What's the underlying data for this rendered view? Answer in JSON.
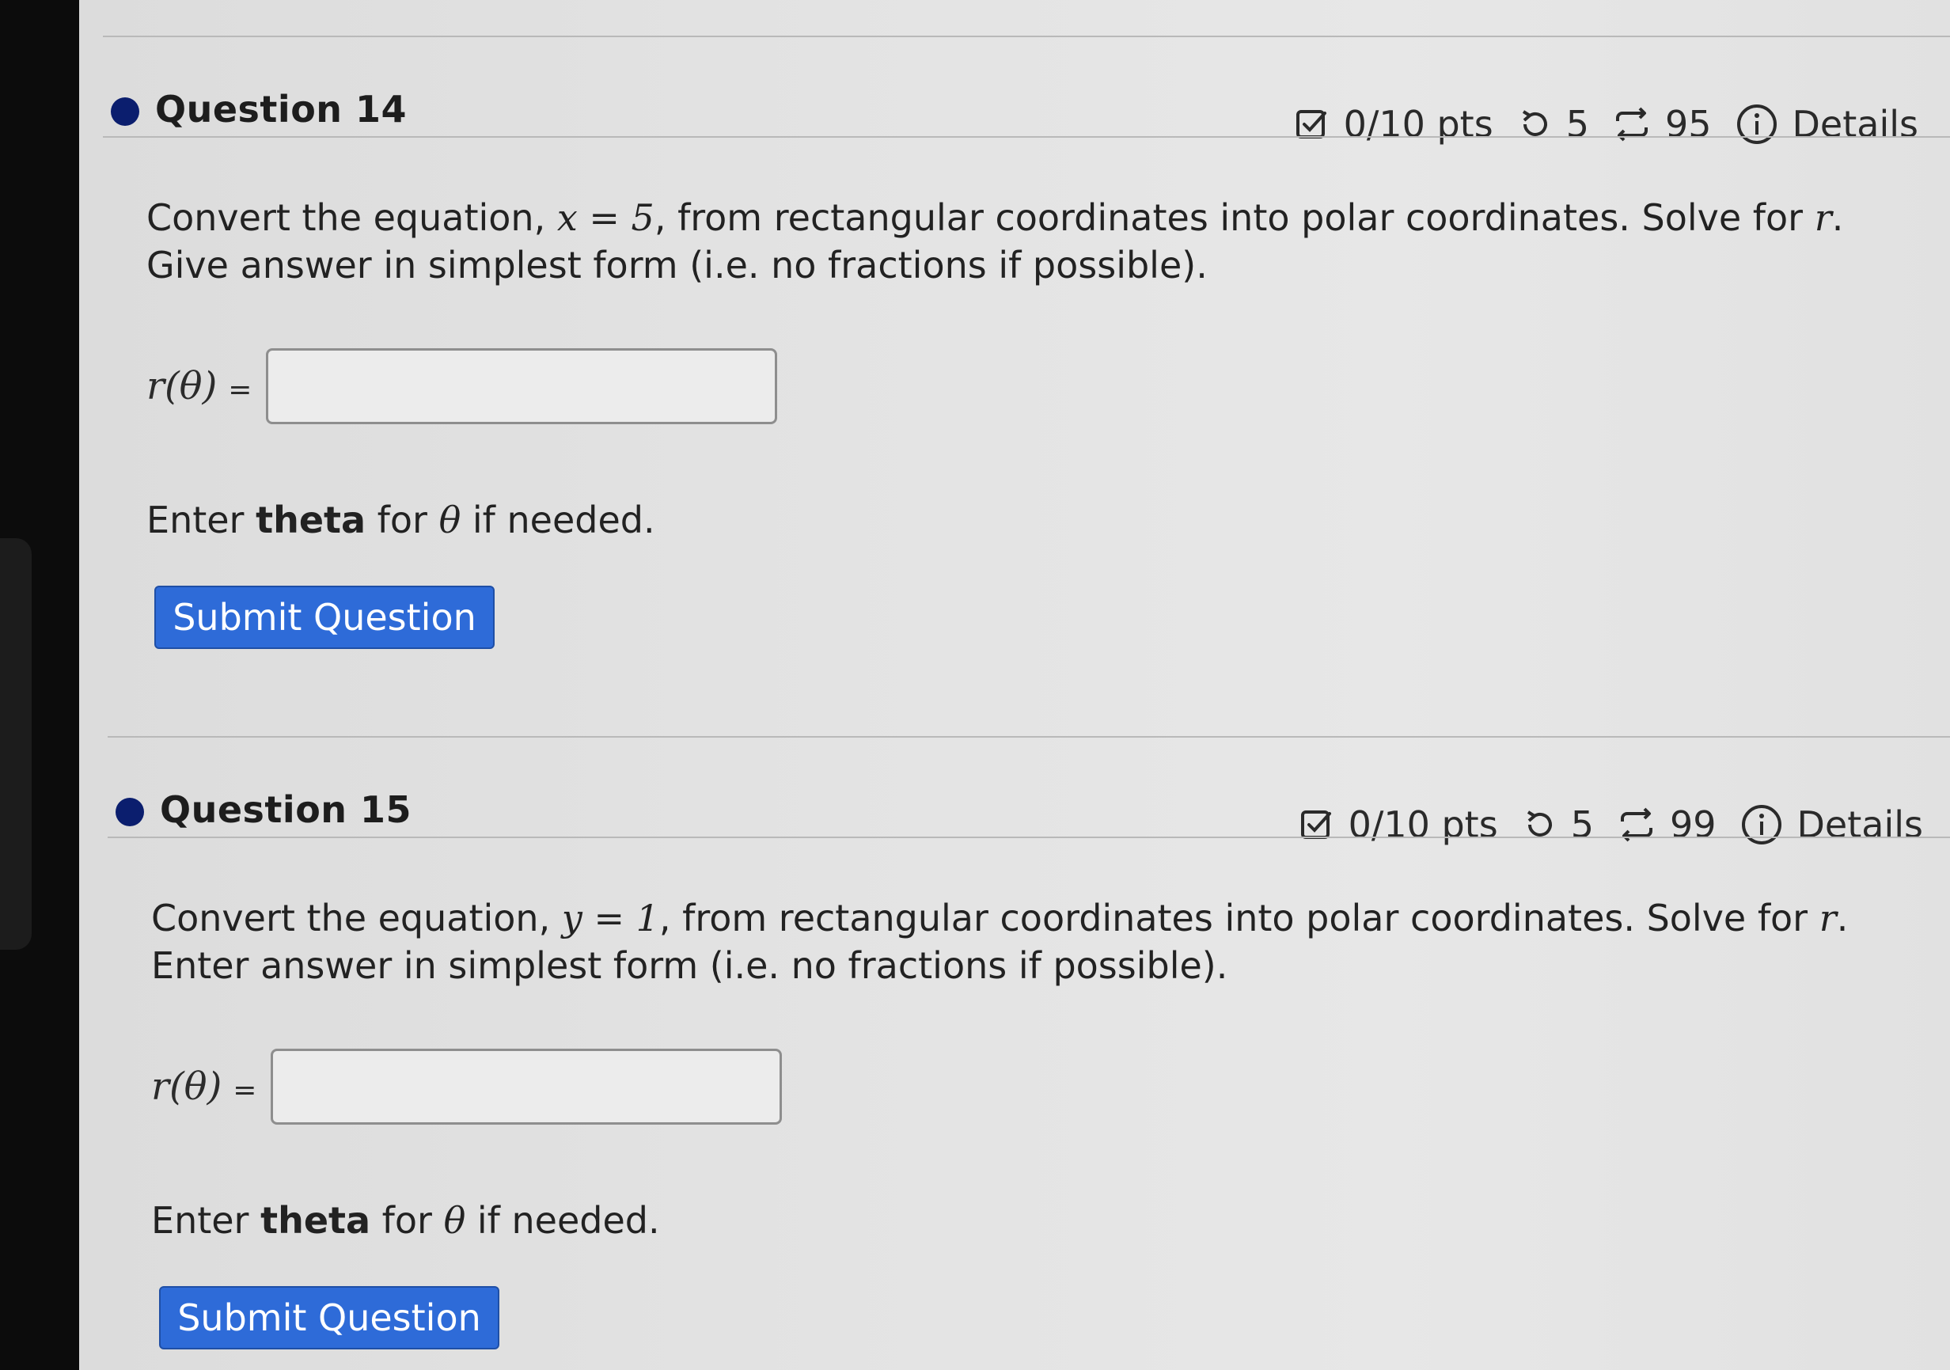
{
  "questions": [
    {
      "title": "Question 14",
      "points": "0/10 pts",
      "retries": "5",
      "submissions": "95",
      "details": "Details",
      "prompt_before": "Convert the equation, ",
      "equation": "x = 5",
      "prompt_mid": ", from rectangular coordinates into polar coordinates. Solve for ",
      "var_r": "r",
      "prompt_after": ". Give answer in simplest form (i.e. no fractions if possible).",
      "answer_label": "r(θ)",
      "answer_eq": "=",
      "answer_value": "",
      "hint_prefix": "Enter ",
      "hint_bold": "theta",
      "hint_mid": " for ",
      "hint_symbol": "θ",
      "hint_suffix": " if needed.",
      "submit_label": "Submit Question"
    },
    {
      "title": "Question 15",
      "points": "0/10 pts",
      "retries": "5",
      "submissions": "99",
      "details": "Details",
      "prompt_before": "Convert the equation, ",
      "equation": "y = 1",
      "prompt_mid": ", from rectangular coordinates into polar coordinates. Solve for ",
      "var_r": "r",
      "prompt_after": ".  Enter answer in simplest form (i.e. no fractions if possible).",
      "answer_label": "r(θ)",
      "answer_eq": "=",
      "answer_value": "",
      "hint_prefix": "Enter ",
      "hint_bold": "theta",
      "hint_mid": " for ",
      "hint_symbol": "θ",
      "hint_suffix": " if needed.",
      "submit_label": "Submit Question"
    }
  ],
  "icons": {
    "points": "checkbox-icon",
    "retries": "retry-icon",
    "submissions": "repeat-icon",
    "details": "info-icon"
  },
  "colors": {
    "submit_button": "#2e6bd8",
    "status_dot": "#0b1e6e"
  }
}
